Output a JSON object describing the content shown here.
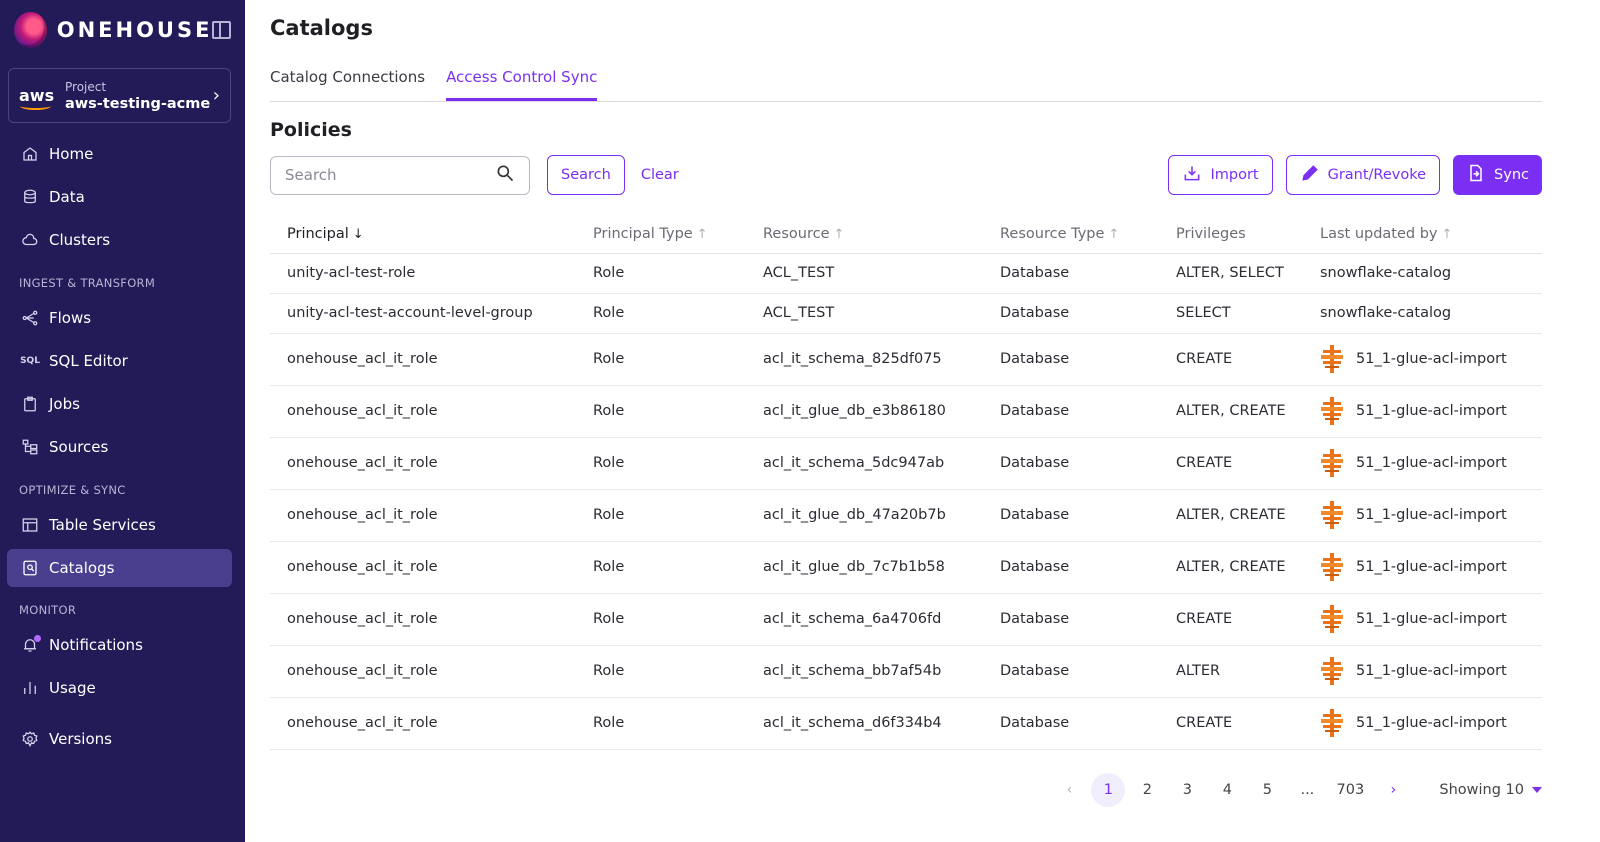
{
  "brand": {
    "name": "ONEHOUSE"
  },
  "project": {
    "label": "Project",
    "name": "aws-testing-acme",
    "provider": "aws"
  },
  "nav": {
    "home": "Home",
    "data": "Data",
    "clusters": "Clusters",
    "section_ingest": "INGEST & TRANSFORM",
    "flows": "Flows",
    "sql_editor": "SQL Editor",
    "jobs": "Jobs",
    "sources": "Sources",
    "section_optimize": "OPTIMIZE & SYNC",
    "table_services": "Table Services",
    "catalogs": "Catalogs",
    "section_monitor": "MONITOR",
    "notifications": "Notifications",
    "usage": "Usage",
    "versions": "Versions"
  },
  "page": {
    "title": "Catalogs"
  },
  "tabs": [
    "Catalog Connections",
    "Access Control Sync"
  ],
  "section": {
    "title": "Policies"
  },
  "toolbar": {
    "search_placeholder": "Search",
    "search_button": "Search",
    "clear": "Clear",
    "import": "Import",
    "grant_revoke": "Grant/Revoke",
    "sync": "Sync"
  },
  "table": {
    "headers": [
      "Principal",
      "Principal Type",
      "Resource",
      "Resource Type",
      "Privileges",
      "Last updated by"
    ],
    "rows": [
      [
        "unity-acl-test-role",
        "Role",
        "ACL_TEST",
        "Database",
        "ALTER, SELECT",
        "snowflake-catalog"
      ],
      [
        "unity-acl-test-account-level-group",
        "Role",
        "ACL_TEST",
        "Database",
        "SELECT",
        "snowflake-catalog"
      ],
      [
        "onehouse_acl_it_role",
        "Role",
        "acl_it_schema_825df075",
        "Database",
        "CREATE",
        "51_1-glue-acl-import"
      ],
      [
        "onehouse_acl_it_role",
        "Role",
        "acl_it_glue_db_e3b86180",
        "Database",
        "ALTER, CREATE",
        "51_1-glue-acl-import"
      ],
      [
        "onehouse_acl_it_role",
        "Role",
        "acl_it_schema_5dc947ab",
        "Database",
        "CREATE",
        "51_1-glue-acl-import"
      ],
      [
        "onehouse_acl_it_role",
        "Role",
        "acl_it_glue_db_47a20b7b",
        "Database",
        "ALTER, CREATE",
        "51_1-glue-acl-import"
      ],
      [
        "onehouse_acl_it_role",
        "Role",
        "acl_it_glue_db_7c7b1b58",
        "Database",
        "ALTER, CREATE",
        "51_1-glue-acl-import"
      ],
      [
        "onehouse_acl_it_role",
        "Role",
        "acl_it_schema_6a4706fd",
        "Database",
        "CREATE",
        "51_1-glue-acl-import"
      ],
      [
        "onehouse_acl_it_role",
        "Role",
        "acl_it_schema_bb7af54b",
        "Database",
        "ALTER",
        "51_1-glue-acl-import"
      ],
      [
        "onehouse_acl_it_role",
        "Role",
        "acl_it_schema_d6f334b4",
        "Database",
        "CREATE",
        "51_1-glue-acl-import"
      ]
    ]
  },
  "pagination": {
    "pages": [
      "1",
      "2",
      "3",
      "4",
      "5",
      "...",
      "703"
    ],
    "current": "1",
    "showing": "Showing 10"
  },
  "colors": {
    "sidebar": "#231b57",
    "accent": "#7b2ff2",
    "active_nav": "#4a3f8f",
    "glue": "#e8731a"
  }
}
